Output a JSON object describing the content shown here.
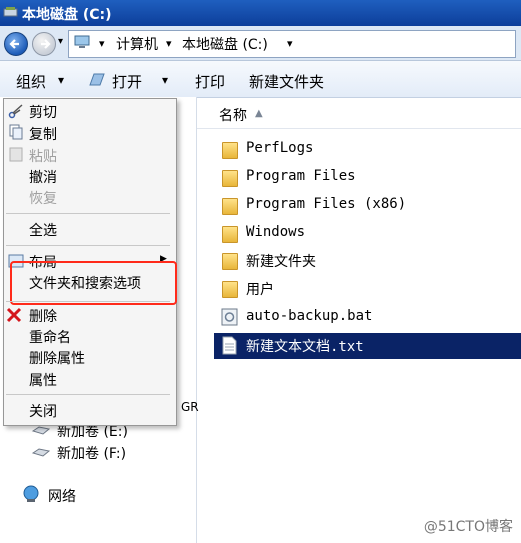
{
  "window": {
    "title": "本地磁盘 (C:)",
    "title_icon": "drive-icon"
  },
  "address": {
    "crumbs": [
      "计算机",
      "本地磁盘 (C:)"
    ],
    "separator": "▾"
  },
  "toolbar": {
    "organize": "组织",
    "open": "打开",
    "print": "打印",
    "new_folder": "新建文件夹",
    "dropdown": "▾"
  },
  "context_menu": {
    "cut": "剪切",
    "copy": "复制",
    "paste": "粘贴",
    "undo": "撤消",
    "redo": "恢复",
    "select_all": "全选",
    "layout": "布局",
    "folder_options": "文件夹和搜索选项",
    "delete": "删除",
    "rename": "重命名",
    "remove_properties": "删除属性",
    "properties": "属性",
    "close": "关闭"
  },
  "column_header": {
    "name": "名称",
    "sort": "▲"
  },
  "files": [
    {
      "name": "PerfLogs",
      "type": "folder"
    },
    {
      "name": "Program Files",
      "type": "folder"
    },
    {
      "name": "Program Files (x86)",
      "type": "folder"
    },
    {
      "name": "Windows",
      "type": "folder"
    },
    {
      "name": "新建文件夹",
      "type": "folder"
    },
    {
      "name": "用户",
      "type": "folder"
    },
    {
      "name": "auto-backup.bat",
      "type": "bat"
    },
    {
      "name": "新建文本文档.txt",
      "type": "txt",
      "selected": true
    }
  ],
  "nav": {
    "gr_fragment": "GR",
    "drive_e": "新加卷 (E:)",
    "drive_f": "新加卷 (F:)",
    "network": "网络"
  },
  "watermark": "@51CTO博客"
}
